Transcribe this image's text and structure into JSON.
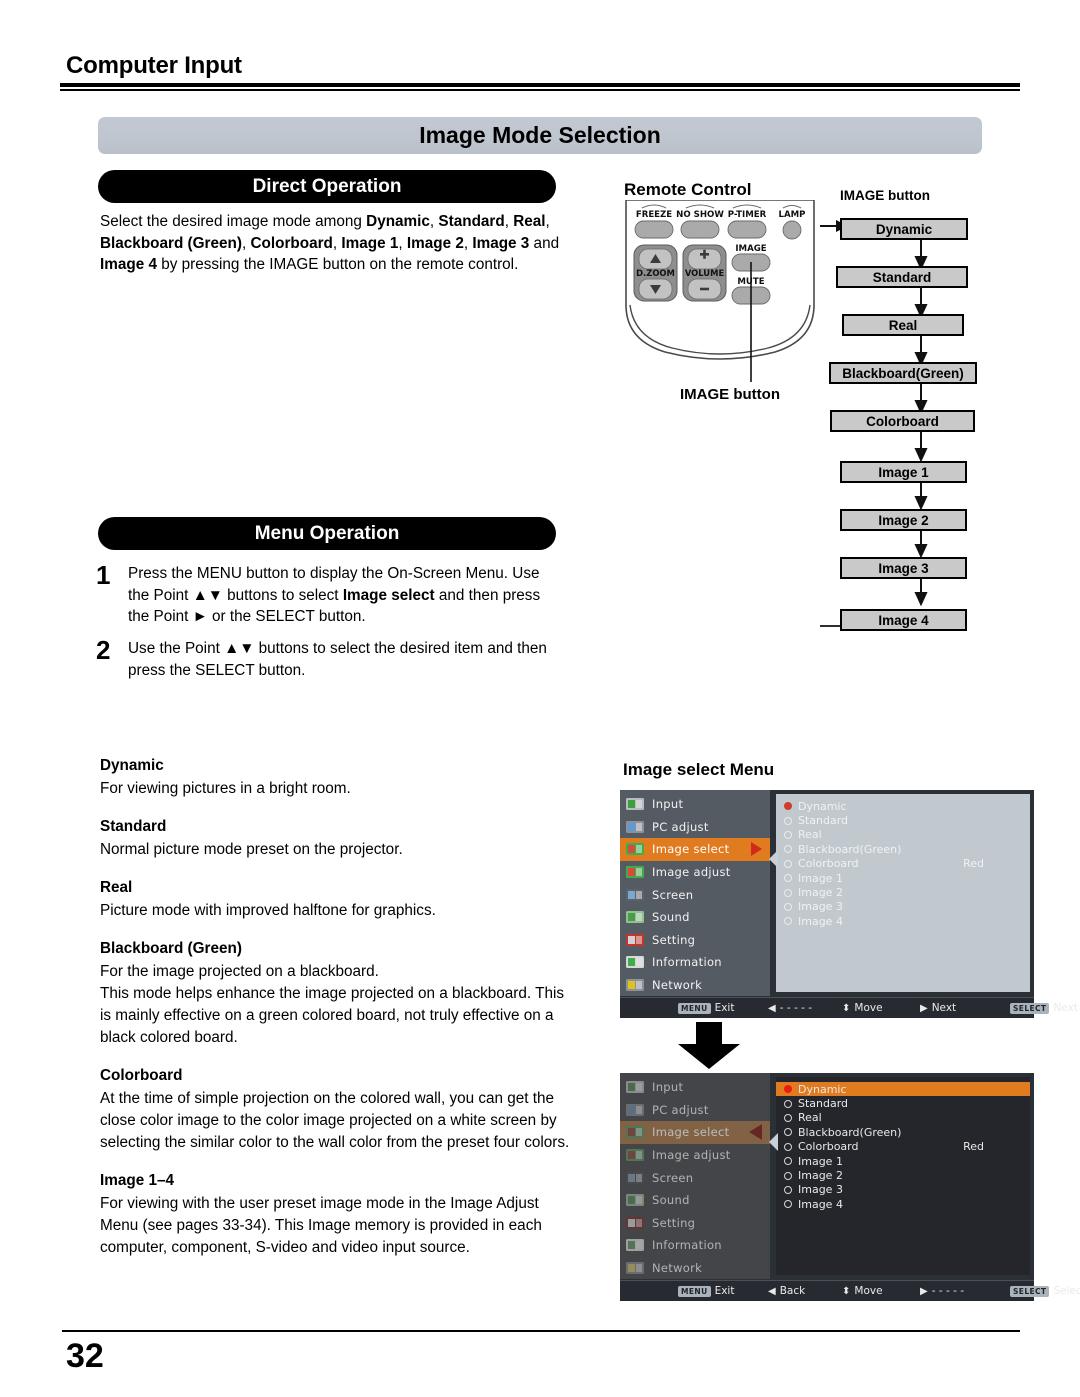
{
  "header": {
    "section_title": "Computer Input"
  },
  "page_banner": {
    "title": "Image Mode Selection"
  },
  "sections": {
    "direct": {
      "bar_label": "Direct Operation",
      "paragraph_parts": [
        {
          "t": "Select the desired image mode among ",
          "b": false
        },
        {
          "t": "Dynamic",
          "b": true
        },
        {
          "t": ", ",
          "b": false
        },
        {
          "t": "Standard",
          "b": true
        },
        {
          "t": ", ",
          "b": false
        },
        {
          "t": "Real",
          "b": true
        },
        {
          "t": ", ",
          "b": false
        },
        {
          "t": "Blackboard (Green)",
          "b": true
        },
        {
          "t": ", ",
          "b": false
        },
        {
          "t": "Colorboard",
          "b": true
        },
        {
          "t": ", ",
          "b": false
        },
        {
          "t": "Image 1",
          "b": true
        },
        {
          "t": ", ",
          "b": false
        },
        {
          "t": "Image 2",
          "b": true
        },
        {
          "t": ", ",
          "b": false
        },
        {
          "t": "Image 3",
          "b": true
        },
        {
          "t": " and ",
          "b": false
        },
        {
          "t": "Image 4",
          "b": true
        },
        {
          "t": " by pressing the IMAGE button on the remote control.",
          "b": false
        }
      ]
    },
    "menu": {
      "bar_label": "Menu Operation",
      "steps": [
        {
          "number": "1",
          "parts": [
            {
              "t": "Press the MENU button to display the On-Screen Menu. Use the Point ▲▼ buttons to select ",
              "b": false
            },
            {
              "t": "Image select",
              "b": true
            },
            {
              "t": " and then press the Point ► or the SELECT button.",
              "b": false
            }
          ]
        },
        {
          "number": "2",
          "parts": [
            {
              "t": "Use the Point ▲▼ buttons to select  the desired item and then press the SELECT button.",
              "b": false
            }
          ]
        }
      ]
    }
  },
  "mode_descriptions": [
    {
      "term": "Dynamic",
      "desc": "For viewing pictures in a bright room."
    },
    {
      "term": "Standard",
      "desc": "Normal picture mode preset on the projector."
    },
    {
      "term": "Real",
      "desc": "Picture mode with improved halftone for graphics."
    },
    {
      "term": "Blackboard (Green)",
      "desc": "For the image projected on a blackboard.\nThis mode helps enhance the image projected on a blackboard. This is mainly effective on a green colored board, not truly effective on a black colored board."
    },
    {
      "term": "Colorboard",
      "desc": "At the time of simple projection on the colored wall, you can get the close color image to the color image projected on a white screen by selecting the similar color to the wall color from the preset four colors."
    },
    {
      "term": "Image 1–4",
      "desc": "For viewing with the user preset image mode in the Image Adjust Menu (see pages 33-34). This Image memory is provided in each computer, component, S-video and video input source."
    }
  ],
  "remote": {
    "label": "Remote Control",
    "caption": "IMAGE button",
    "buttons": [
      {
        "name": "FREEZE"
      },
      {
        "name": "NO SHOW"
      },
      {
        "name": "P-TIMER"
      },
      {
        "name": "LAMP"
      },
      {
        "name": "D.ZOOM"
      },
      {
        "name": "VOLUME"
      },
      {
        "name": "IMAGE"
      },
      {
        "name": "MUTE"
      }
    ]
  },
  "flow": {
    "label": "IMAGE button",
    "items": [
      {
        "label": "Dynamic"
      },
      {
        "label": "Standard"
      },
      {
        "label": "Real"
      },
      {
        "label": "Blackboard(Green)"
      },
      {
        "label": "Colorboard"
      },
      {
        "label": "Image 1"
      },
      {
        "label": "Image 2"
      },
      {
        "label": "Image 3"
      },
      {
        "label": "Image 4"
      }
    ]
  },
  "osd": {
    "label": "Image select Menu",
    "menu_items": [
      {
        "label": "Input",
        "icon": "input-icon"
      },
      {
        "label": "PC adjust",
        "icon": "monitor-icon"
      },
      {
        "label": "Image select",
        "icon": "image-select-icon"
      },
      {
        "label": "Image adjust",
        "icon": "image-adjust-icon"
      },
      {
        "label": "Screen",
        "icon": "screen-icon"
      },
      {
        "label": "Sound",
        "icon": "speaker-icon"
      },
      {
        "label": "Setting",
        "icon": "tools-icon"
      },
      {
        "label": "Information",
        "icon": "info-icon"
      },
      {
        "label": "Network",
        "icon": "network-icon"
      }
    ],
    "options": [
      {
        "label": "Dynamic",
        "sub": "",
        "selected": true
      },
      {
        "label": "Standard",
        "sub": "",
        "selected": false
      },
      {
        "label": "Real",
        "sub": "",
        "selected": false
      },
      {
        "label": "Blackboard(Green)",
        "sub": "",
        "selected": false
      },
      {
        "label": "Colorboard",
        "sub": "Red",
        "selected": false
      },
      {
        "label": "Image 1",
        "sub": "",
        "selected": false
      },
      {
        "label": "Image 2",
        "sub": "",
        "selected": false
      },
      {
        "label": "Image 3",
        "sub": "",
        "selected": false
      },
      {
        "label": "Image 4",
        "sub": "",
        "selected": false
      }
    ],
    "colorboard_value": "Red",
    "screen1": {
      "bottom": [
        {
          "key": "MENU",
          "glyph": "",
          "label": "Exit"
        },
        {
          "key": "",
          "glyph": "◀",
          "label": "- - - - -"
        },
        {
          "key": "",
          "glyph": "⬍",
          "label": "Move"
        },
        {
          "key": "",
          "glyph": "▶",
          "label": "Next"
        },
        {
          "key": "SELECT",
          "glyph": "",
          "label": "Next"
        }
      ]
    },
    "screen2": {
      "bottom": [
        {
          "key": "MENU",
          "glyph": "",
          "label": "Exit"
        },
        {
          "key": "",
          "glyph": "◀",
          "label": "Back"
        },
        {
          "key": "",
          "glyph": "⬍",
          "label": "Move"
        },
        {
          "key": "",
          "glyph": "▶",
          "label": "- - - - -"
        },
        {
          "key": "SELECT",
          "glyph": "",
          "label": "Select"
        }
      ]
    }
  },
  "footer": {
    "page_number": "32"
  },
  "colors": {
    "banner": "#c0c6cf",
    "bar": "#000000",
    "osd_selected": "#e07b20",
    "osd_radio_on": "#ee1b10",
    "flow_box": "#c9c9c9"
  }
}
